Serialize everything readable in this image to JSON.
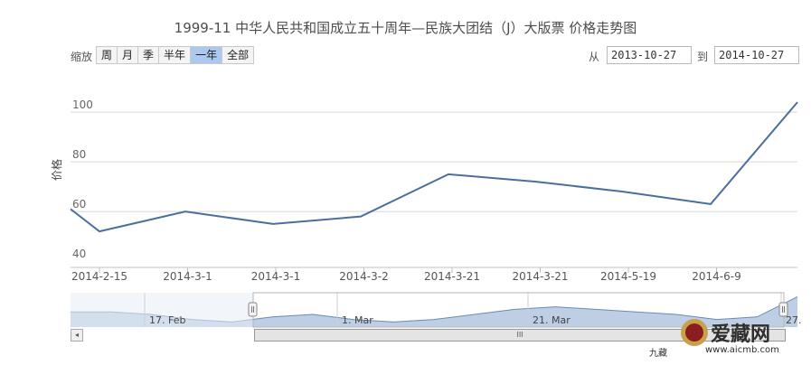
{
  "title": "1999-11 中华人民共和国成立五十周年—民族大团结（J）大版票 价格走势图",
  "zoom": {
    "label": "缩放",
    "buttons": [
      "周",
      "月",
      "季",
      "半年",
      "一年",
      "全部"
    ],
    "active": "一年"
  },
  "range": {
    "from_label": "从",
    "from_value": "2013-10-27",
    "to_label": "到",
    "to_value": "2014-10-27"
  },
  "colors": {
    "line": "#4a6f9f",
    "navigator_fill": "#a7bddc",
    "navigator_outside": "#e8edf4",
    "grid": "#d8d8d8",
    "zoom_active": "#acc8ee"
  },
  "chart_data": {
    "type": "line",
    "ylabel": "价格",
    "ylim": [
      40,
      105
    ],
    "yticks": [
      40,
      60,
      80,
      100
    ],
    "xticks": [
      "2014-2-15",
      "2014-3-1",
      "2014-3-1",
      "2014-3-2",
      "2014-3-21",
      "2014-3-21",
      "2014-5-19",
      "2014-6-9"
    ],
    "grid": true,
    "series": [
      {
        "values": [
          61,
          52,
          60,
          55,
          58,
          75,
          72,
          68,
          63,
          104
        ]
      }
    ],
    "navigator": {
      "labels": [
        "17. Feb",
        "1. Mar",
        "21. Mar",
        "27."
      ],
      "values": [
        46,
        46,
        45,
        43,
        42,
        44,
        45,
        43,
        42,
        43,
        45,
        47,
        48,
        47,
        46,
        45,
        43,
        44,
        52
      ]
    }
  },
  "scrollbar": {
    "left_arrow": "◂",
    "thumb_grip": "III"
  },
  "watermark": {
    "brand": "爱藏网",
    "domain": "www.aicmb.com",
    "sub": "九藏"
  }
}
